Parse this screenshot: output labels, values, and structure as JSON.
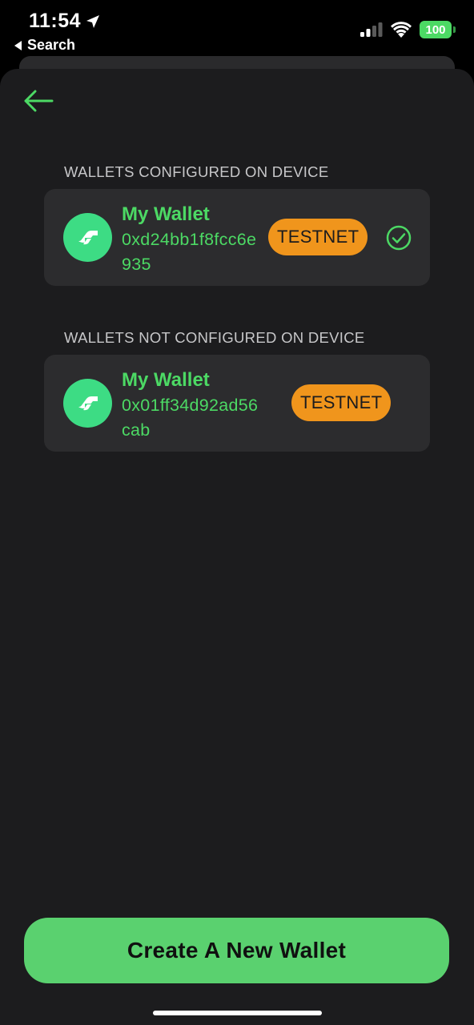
{
  "status_bar": {
    "time": "11:54",
    "back_app": "Search",
    "battery": "100"
  },
  "sections": {
    "configured_label": "WALLETS CONFIGURED ON DEVICE",
    "not_configured_label": "WALLETS NOT CONFIGURED ON DEVICE"
  },
  "wallets": [
    {
      "name": "My Wallet",
      "address": "0xd24bb1f8fcc6e935",
      "network": "TESTNET",
      "selected": true
    },
    {
      "name": "My Wallet",
      "address": "0x01ff34d92ad56cab",
      "network": "TESTNET",
      "selected": false
    }
  ],
  "actions": {
    "create_label": "Create A New Wallet"
  },
  "colors": {
    "accent": "#4cd964",
    "badge": "#f0951c",
    "background": "#1c1c1e",
    "card": "#2c2c2e"
  }
}
